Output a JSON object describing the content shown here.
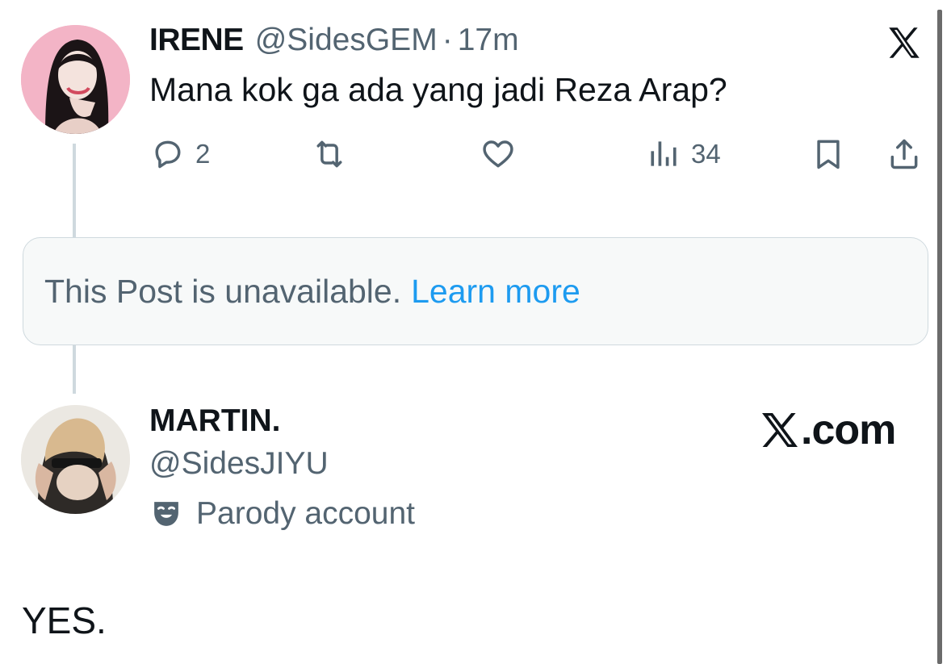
{
  "post": {
    "display_name": "IRENE",
    "handle": "@SidesGEM",
    "separator": "·",
    "time": "17m",
    "text": "Mana kok ga ada yang jadi Reza Arap?",
    "actions": {
      "reply_icon": "reply-icon",
      "reply_count": "2",
      "repost_icon": "repost-icon",
      "like_icon": "heart-icon",
      "views_icon": "views-icon",
      "views_count": "34",
      "bookmark_icon": "bookmark-icon",
      "share_icon": "share-icon"
    }
  },
  "unavailable": {
    "message": "This Post is unavailable.",
    "link": "Learn more"
  },
  "reply": {
    "display_name": "MARTIN.",
    "handle": "@SidesJIYU",
    "badge_label": "Parody account",
    "text": "YES."
  },
  "branding": {
    "watermark_text": ".com"
  },
  "colors": {
    "text_primary": "#0f1419",
    "text_secondary": "#536471",
    "link": "#1d9bf0",
    "border": "#cfd9de",
    "box_bg": "#f7f9f9"
  }
}
